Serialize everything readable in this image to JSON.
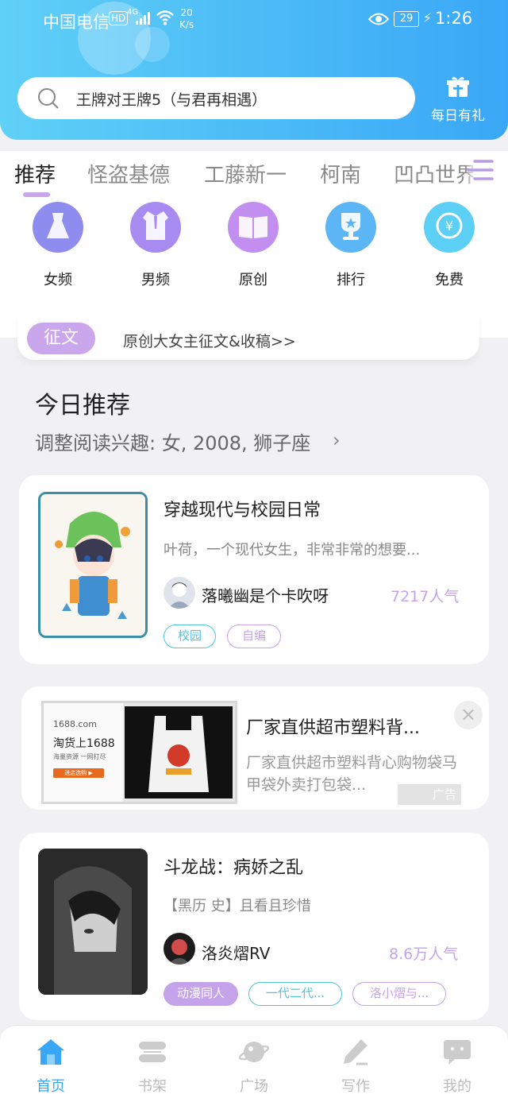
{
  "status_bar": {
    "carrier": "中国电信",
    "hd": "HD",
    "network": "4G",
    "speed_value": "20",
    "speed_unit": "K/s",
    "battery": "29",
    "time": "1:26"
  },
  "search": {
    "placeholder": "王牌对王牌5（与君再相遇）"
  },
  "gift": {
    "label": "每日有礼"
  },
  "tabs": [
    {
      "label": "推荐",
      "active": true
    },
    {
      "label": "怪盗基德"
    },
    {
      "label": "工藤新一"
    },
    {
      "label": "柯南"
    },
    {
      "label": "凹凸世界"
    }
  ],
  "categories": [
    {
      "label": "女频",
      "icon": "dress-icon",
      "color": "#8f8cf0"
    },
    {
      "label": "男频",
      "icon": "shirt-icon",
      "color": "#a78bf0"
    },
    {
      "label": "原创",
      "icon": "book-icon",
      "color": "#c28ef0"
    },
    {
      "label": "排行",
      "icon": "trophy-icon",
      "color": "#5cb6f5"
    },
    {
      "label": "免费",
      "icon": "coin-icon",
      "color": "#5ccff5"
    }
  ],
  "banner": {
    "tag": "征文",
    "text": "原创大女主征文&收稿>>"
  },
  "section": {
    "title": "今日推荐",
    "subtitle": "调整阅读兴趣: 女, 2008, 狮子座"
  },
  "books": [
    {
      "title": "穿越现代与校园日常",
      "desc": "叶荷，一个现代女生，非常非常的想要...",
      "author": "落曦幽是个卡吹呀",
      "popularity": "7217人气",
      "tags": [
        {
          "label": "校园",
          "color": "#4fc3e0"
        },
        {
          "label": "自编",
          "color": "#c5a3ea"
        }
      ]
    },
    {
      "title": "斗龙战：病娇之乱",
      "desc": "【黑历 史】且看且珍惜",
      "author": "洛炎熠RV",
      "popularity": "8.6万人气",
      "tags": [
        {
          "label": "动漫同人",
          "color": "#c5a3ea",
          "filled": true
        },
        {
          "label": "一代二代...",
          "color": "#4fc3e0"
        },
        {
          "label": "洛小熠与...",
          "color": "#c5a3ea"
        }
      ]
    }
  ],
  "ad": {
    "title": "厂家直供超市塑料背...",
    "desc": "厂家直供超市塑料背心购物袋马甲袋外卖打包袋...",
    "badge": "广告",
    "image_text": {
      "brand": "1688.com",
      "slogan": "淘货上1688",
      "sub": "海量资源 一网打尽",
      "button": "进店选购 ▶"
    }
  },
  "bottom_nav": [
    {
      "label": "首页",
      "active": true
    },
    {
      "label": "书架"
    },
    {
      "label": "广场"
    },
    {
      "label": "写作"
    },
    {
      "label": "我的"
    }
  ]
}
